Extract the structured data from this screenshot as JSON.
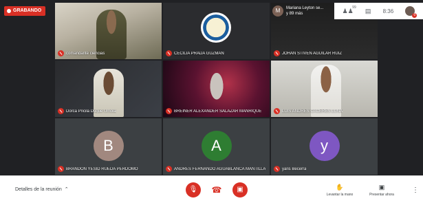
{
  "recording_label": "GRABANDO",
  "presenter": {
    "initial": "M",
    "line1": "Mariana Leyton se...",
    "line2": "y 89 más"
  },
  "topbar": {
    "people_icon": "people-icon",
    "people_count": "99",
    "chat_icon": "chat-icon",
    "time": "8:36",
    "self_badge": "0"
  },
  "tiles": [
    {
      "name": "comandante ciencias",
      "kind": "video"
    },
    {
      "name": "CECILIA PRADA GUZMAN",
      "kind": "video"
    },
    {
      "name": "JOHAN STIVEN AGUILAR RUIZ",
      "kind": "video"
    },
    {
      "name": "Dorca Pricila Duque Urriola",
      "kind": "video"
    },
    {
      "name": "BREINER ALEXANDER SALAZAR MANRIQUE",
      "kind": "video"
    },
    {
      "name": "LUIS ANDRES CACERES LUNA",
      "kind": "video"
    },
    {
      "name": "BRANDON YESID RUEDA PERDOMO",
      "kind": "avatar",
      "initial": "B",
      "color": "#a1887f"
    },
    {
      "name": "ANDRES FERNANDO AGUABLANCA MANTILLA",
      "kind": "avatar",
      "initial": "A",
      "color": "#2e7d32"
    },
    {
      "name": "yaris Becerra",
      "kind": "avatar",
      "initial": "y",
      "color": "#7e57c2"
    }
  ],
  "bottom": {
    "details_label": "Detalles de la reunión",
    "raise_hand_label": "Levantar la mano",
    "present_label": "Presentar ahora"
  },
  "colors": {
    "accent_red": "#d93025",
    "stage_bg": "#202124",
    "tile_bg": "#3c4043"
  }
}
